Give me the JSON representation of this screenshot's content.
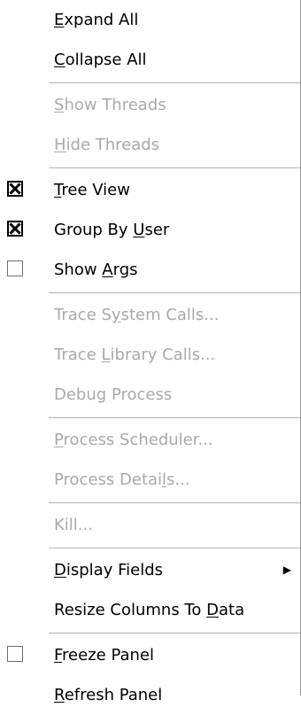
{
  "menu": {
    "items": [
      {
        "id": "expand-all",
        "before": "",
        "key": "E",
        "after": "xpand All",
        "enabled": true
      },
      {
        "id": "collapse-all",
        "before": "",
        "key": "C",
        "after": "ollapse All",
        "enabled": true
      },
      {
        "id": "show-threads",
        "before": "",
        "key": "S",
        "after": "how Threads",
        "enabled": false
      },
      {
        "id": "hide-threads",
        "before": "",
        "key": "H",
        "after": "ide Threads",
        "enabled": false
      },
      {
        "id": "tree-view",
        "before": "",
        "key": "T",
        "after": "ree View",
        "enabled": true,
        "checked": true
      },
      {
        "id": "group-by-user",
        "before": "Group By ",
        "key": "U",
        "after": "ser",
        "enabled": true,
        "checked": true
      },
      {
        "id": "show-args",
        "before": "Show ",
        "key": "A",
        "after": "rgs",
        "enabled": true,
        "checked": false
      },
      {
        "id": "trace-system-calls",
        "before": "Trace S",
        "key": "y",
        "after": "stem Calls...",
        "enabled": false
      },
      {
        "id": "trace-library-calls",
        "before": "Trace ",
        "key": "L",
        "after": "ibrary Calls...",
        "enabled": false
      },
      {
        "id": "debug-process",
        "before": "Debu",
        "key": "g",
        "after": " Process",
        "enabled": false
      },
      {
        "id": "process-scheduler",
        "before": "",
        "key": "P",
        "after": "rocess Scheduler...",
        "enabled": false
      },
      {
        "id": "process-details",
        "before": "Process Detai",
        "key": "l",
        "after": "s...",
        "enabled": false
      },
      {
        "id": "kill",
        "before": "Kill...",
        "key": "",
        "after": "",
        "enabled": false
      },
      {
        "id": "display-fields",
        "before": "",
        "key": "D",
        "after": "isplay Fields",
        "enabled": true,
        "submenu": true
      },
      {
        "id": "resize-columns",
        "before": "Resize Columns To ",
        "key": "D",
        "after": "ata",
        "enabled": true
      },
      {
        "id": "freeze-panel",
        "before": "",
        "key": "F",
        "after": "reeze Panel",
        "enabled": true,
        "checked": false
      },
      {
        "id": "refresh-panel",
        "before": "",
        "key": "R",
        "after": "efresh Panel",
        "enabled": true
      }
    ],
    "submenu_arrow_icon": "triangle-right-icon"
  }
}
